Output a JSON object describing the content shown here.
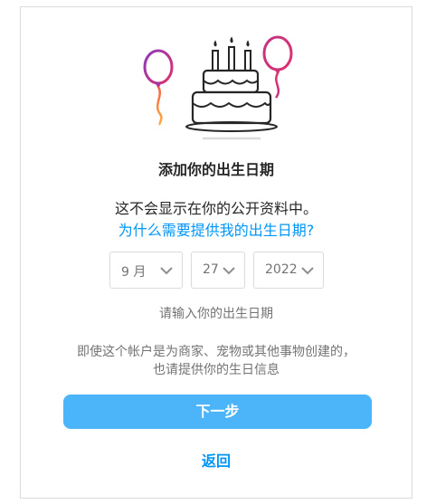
{
  "heading": "添加你的出生日期",
  "info": {
    "line1": "这不会显示在你的公开资料中。",
    "why_link": "为什么需要提供我的出生日期?"
  },
  "birthday": {
    "month": "9 月",
    "day": "27",
    "year": "2022"
  },
  "hint": "请输入你的出生日期",
  "note": {
    "line1": "即使这个帐户是为商家、宠物或其他事物创建的，",
    "line2": "也请提供你的生日信息"
  },
  "buttons": {
    "next": "下一步",
    "back": "返回"
  },
  "icons": {
    "illustration": "birthday-cake-balloons-icon",
    "dropdown": "chevron-down-icon"
  },
  "colors": {
    "primary_button": "#4cb5f9",
    "link": "#0095f6",
    "muted_text": "#737373",
    "border": "#dbdbdb"
  }
}
